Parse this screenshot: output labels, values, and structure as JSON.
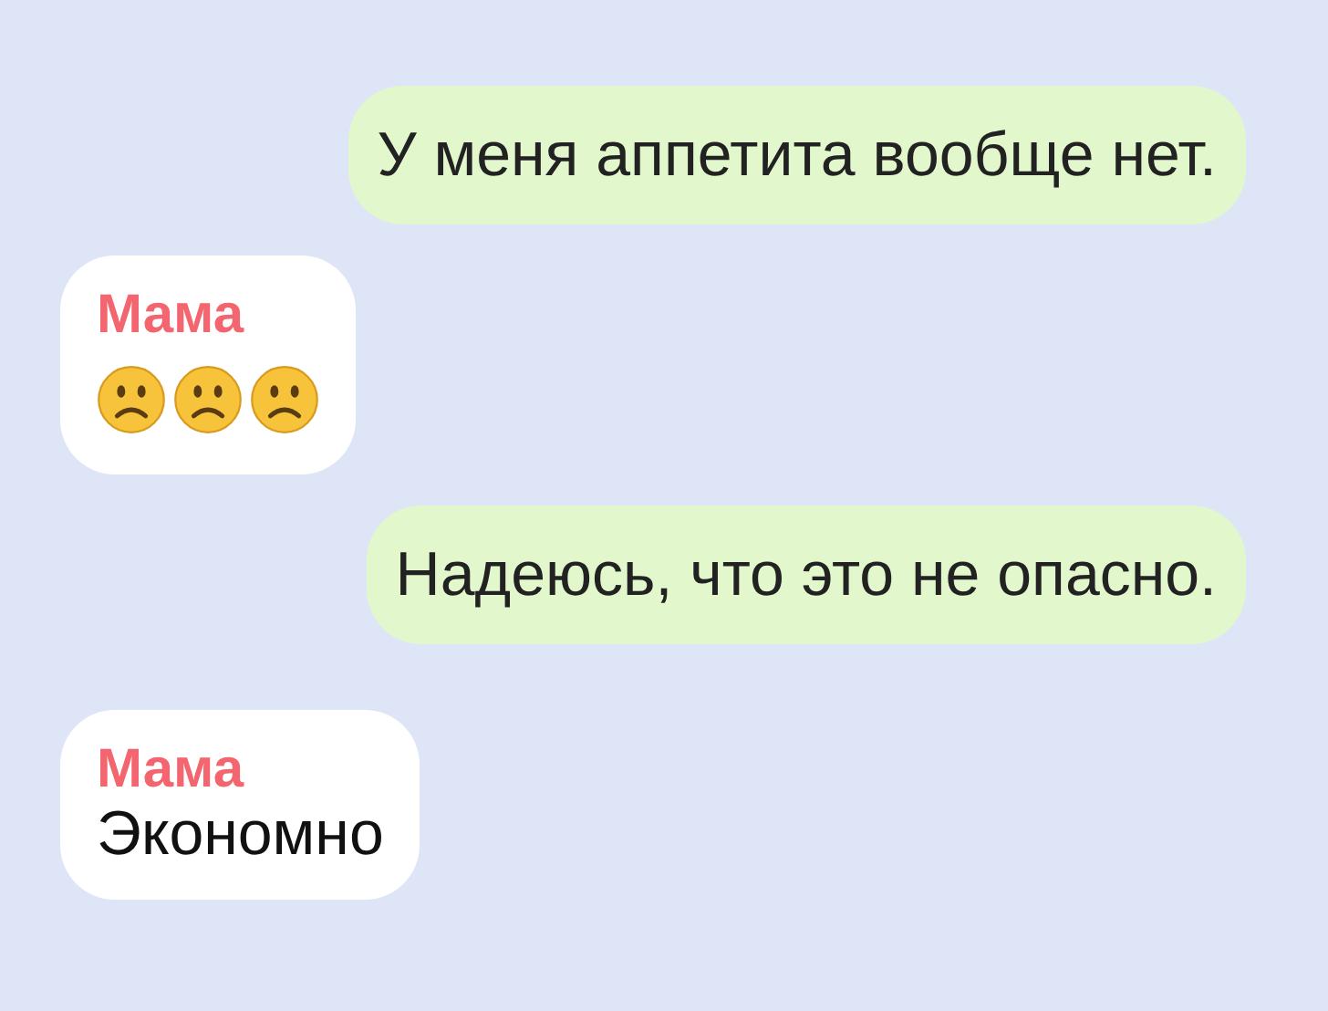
{
  "messages": [
    {
      "kind": "outgoing",
      "text": "У меня аппетита вообще нет."
    },
    {
      "kind": "incoming",
      "sender": "Мама",
      "emojis": [
        {
          "kind": "frown"
        },
        {
          "kind": "frown"
        },
        {
          "kind": "frown"
        }
      ]
    },
    {
      "kind": "outgoing",
      "text": "Надеюсь, что это не опасно."
    },
    {
      "kind": "incoming",
      "sender": "Мама",
      "text": "Экономно"
    }
  ]
}
